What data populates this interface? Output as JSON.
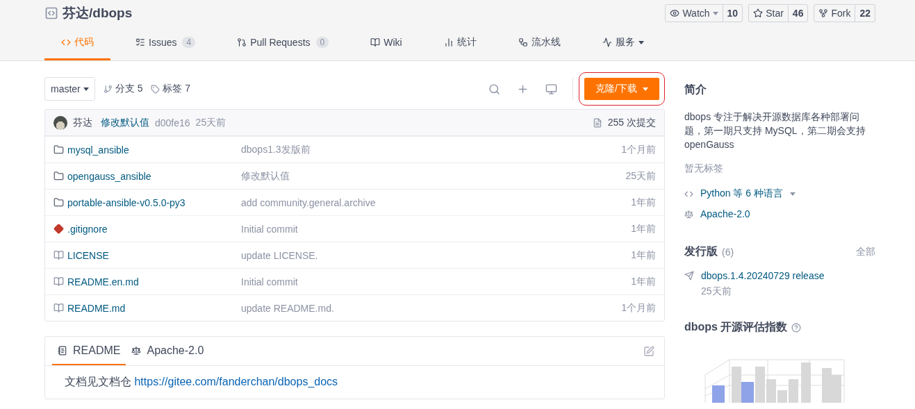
{
  "repo": {
    "owner": "芬达",
    "separator": "/",
    "name": "dbops"
  },
  "actions": [
    {
      "label": "Watch",
      "count": "10",
      "dropdown": true
    },
    {
      "label": "Star",
      "count": "46",
      "dropdown": false
    },
    {
      "label": "Fork",
      "count": "22",
      "dropdown": false
    }
  ],
  "tabs": [
    {
      "label": "代码",
      "selected": true
    },
    {
      "label": "Issues",
      "badge": "4",
      "selected": false
    },
    {
      "label": "Pull Requests",
      "badge": "0",
      "selected": false
    },
    {
      "label": "Wiki",
      "selected": false
    },
    {
      "label": "统计",
      "selected": false
    },
    {
      "label": "流水线",
      "selected": false
    },
    {
      "label": "服务",
      "dropdown": true,
      "selected": false
    }
  ],
  "toolbar": {
    "branch": "master",
    "branches": "分支 5",
    "tags": "标签 7",
    "clone_button": "克隆/下载"
  },
  "last_commit": {
    "author": "芬达",
    "message": "修改默认值",
    "hash": "d00fe16",
    "time": "25天前",
    "commits": "255 次提交"
  },
  "files": [
    {
      "kind": "folder",
      "name": "mysql_ansible",
      "message": "dbops1.3发版前",
      "time": "1个月前"
    },
    {
      "kind": "folder",
      "name": "opengauss_ansible",
      "message": "修改默认值",
      "time": "25天前"
    },
    {
      "kind": "folder",
      "name": "portable-ansible-v0.5.0-py3",
      "message": "add community.general.archive",
      "time": "1年前"
    },
    {
      "kind": "git",
      "name": ".gitignore",
      "message": "Initial commit",
      "time": "1年前"
    },
    {
      "kind": "file",
      "name": "LICENSE",
      "message": "update LICENSE.",
      "time": "1年前"
    },
    {
      "kind": "file",
      "name": "README.en.md",
      "message": "Initial commit",
      "time": "1年前"
    },
    {
      "kind": "file",
      "name": "README.md",
      "message": "update README.md.",
      "time": "1个月前"
    }
  ],
  "readme": {
    "tabs": [
      {
        "label": "README",
        "selected": true
      },
      {
        "label": "Apache-2.0",
        "selected": false
      }
    ],
    "text": "文档见文档仓",
    "link": "https://gitee.com/fanderchan/dbops_docs"
  },
  "sidebar": {
    "intro_title": "简介",
    "description": "dbops 专注于解决开源数据库各种部署问题，第一期只支持 MySQL，第二期会支持 openGauss",
    "no_tags": "暂无标签",
    "language": "Python 等 6 种语言",
    "license": "Apache-2.0",
    "releases_title": "发行版",
    "releases_count": "(6)",
    "releases_all": "全部",
    "release_name": "dbops.1.4.20240729 release",
    "release_time": "25天前",
    "index_title": "dbops 开源评估指数"
  }
}
